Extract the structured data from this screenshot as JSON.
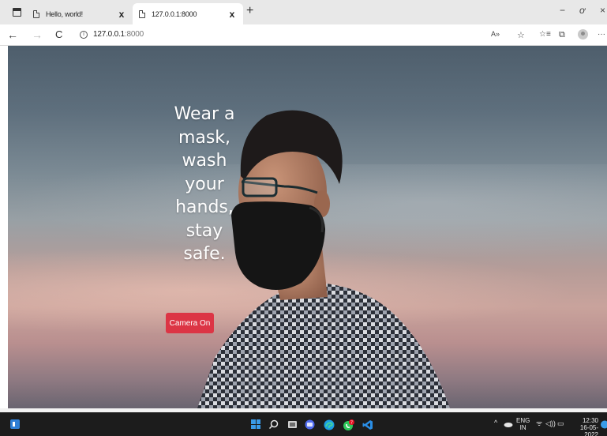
{
  "browser": {
    "tabs": [
      {
        "title": "Hello, world!",
        "close": "x",
        "active": false
      },
      {
        "title": "127.0.0.1:8000",
        "close": "x",
        "active": true
      }
    ],
    "new_tab": "+",
    "window_controls": {
      "minimize": "−",
      "restore": "🗗",
      "close": "×"
    },
    "nav": {
      "back": "←",
      "forward": "→",
      "reload": "C"
    },
    "address": {
      "host": "127.0.0.1",
      "port": ":8000"
    },
    "toolbar_icons": [
      "read-aloud-icon",
      "favorite-add-icon",
      "favorites-icon",
      "collections-icon",
      "profile-icon",
      "more-icon"
    ],
    "toolbar_glyphs": {
      "read_aloud": "A»",
      "favorite_add": "☆",
      "favorites": "☆≡",
      "collections": "⧉",
      "more": "···"
    }
  },
  "page": {
    "headline": "Wear a\nmask,\nwash\nyour\nhands,\nstay\nsafe.",
    "button_label": "Camera On",
    "button_color": "#dc3545"
  },
  "taskbar": {
    "apps": [
      "start-icon",
      "search-icon",
      "task-view-icon",
      "chat-icon",
      "edge-icon",
      "whatsapp-icon",
      "vscode-icon"
    ],
    "whatsapp_badge": "7",
    "tray": {
      "chevron": "^",
      "language": "ENG",
      "region": "IN",
      "time": "12:30",
      "date": "16-05-2022"
    }
  },
  "colors": {
    "tabstrip": "#e8e8e8",
    "taskbar": "#1c1c1c",
    "accent_button": "#dc3545"
  }
}
